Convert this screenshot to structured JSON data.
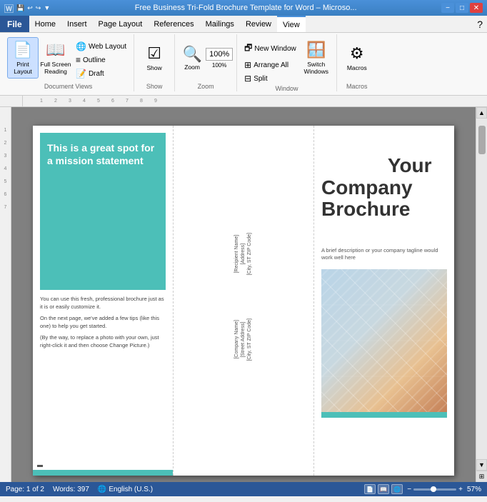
{
  "titleBar": {
    "title": "Free Business Tri-Fold Brochure Template for Word – Microsо...",
    "minimize": "−",
    "maximize": "□",
    "close": "✕"
  },
  "menuBar": {
    "items": [
      "File",
      "Home",
      "Insert",
      "Page Layout",
      "References",
      "Mailings",
      "Review",
      "View"
    ]
  },
  "ribbon": {
    "documentViews": {
      "label": "Document Views",
      "printLayout": "Print\nLayout",
      "fullScreenReading": "Full Screen\nReading",
      "webLayout": "Web Layout",
      "outline": "Outline",
      "draft": "Draft"
    },
    "show": {
      "label": "Show",
      "btn": "Show"
    },
    "zoom": {
      "label": "Zoom",
      "zoomBtn": "Zoom",
      "percent": "100%"
    },
    "window": {
      "label": "Window",
      "newWindow": "New Window",
      "arrangeAll": "Arrange All",
      "split": "Split",
      "switchWindows": "Switch\nWindows"
    },
    "macros": {
      "label": "Macros",
      "btn": "Macros"
    }
  },
  "ruler": {
    "marks": [
      "1",
      "2",
      "3",
      "4",
      "5",
      "6",
      "7",
      "8",
      "9"
    ]
  },
  "brochure": {
    "leftPanel": {
      "tealBoxTitle": "This is a great spot for a mission statement",
      "paragraph1": "You can use this fresh, professional brochure just as it is or easily customize it.",
      "paragraph2": "On the next page, we've added a few tips (like this one) to help you get started.",
      "paragraph3": "(By the way, to replace a photo with your own, just right-click it and then choose Change Picture.)"
    },
    "middlePanel": {
      "addressLine1": "[Recipient Name]",
      "addressLine2": "[Address]",
      "addressLine3": "[City, ST  ZIP Code]",
      "companyLine1": "[Company Name]",
      "companyLine2": "[Street Address]",
      "companyLine3": "[City, ST  ZIP Code]"
    },
    "rightPanel": {
      "companyTitle": "Your\nCompany\nBrochure",
      "subtitle": "A brief description or your company tagline would work well here"
    }
  },
  "statusBar": {
    "page": "Page: 1 of 2",
    "words": "Words: 397",
    "language": "English (U.S.)",
    "zoom": "57%",
    "zoomMinus": "−",
    "zoomPlus": "+"
  }
}
